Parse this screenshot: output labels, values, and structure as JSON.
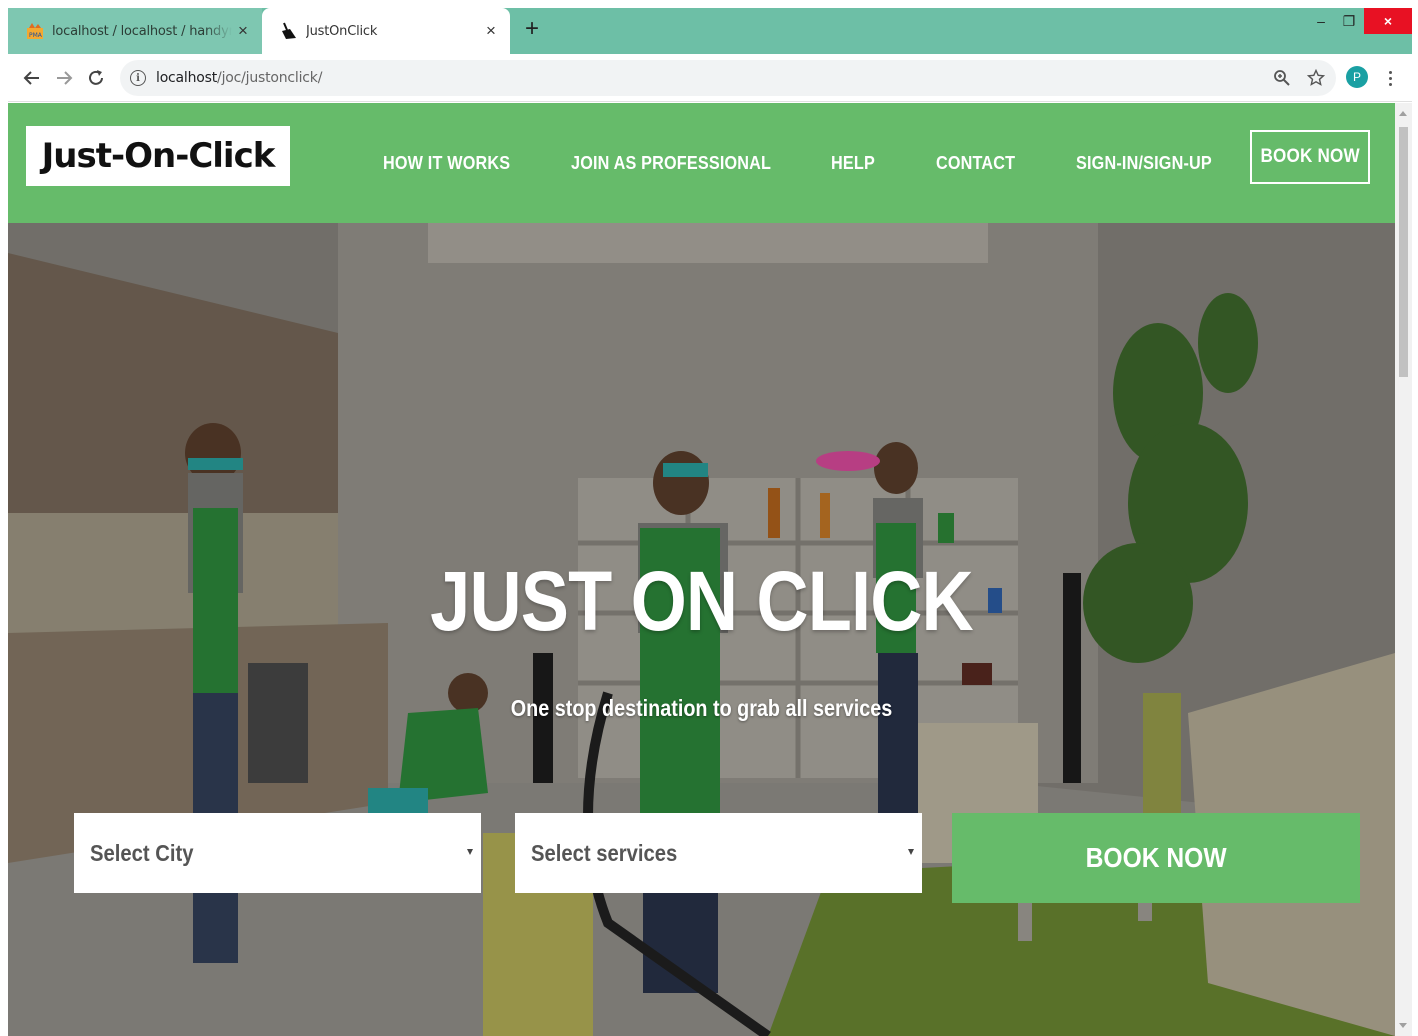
{
  "browser": {
    "tabs": [
      {
        "title": "localhost / localhost / handyman",
        "favicon": "phpmyadmin-icon",
        "active": false
      },
      {
        "title": "JustOnClick",
        "favicon": "broom-icon",
        "active": true
      }
    ],
    "new_tab": "+",
    "close_tab": "×",
    "window_controls": {
      "minimize": "–",
      "maximize": "❐",
      "close": "×"
    },
    "url_host": "localhost",
    "url_path": "/joc/justonclick/",
    "profile_initial": "P"
  },
  "site": {
    "logo": "Just-On-Click",
    "nav": [
      {
        "label": "HOW IT WORKS"
      },
      {
        "label": "JOIN AS PROFESSIONAL"
      },
      {
        "label": "HELP"
      },
      {
        "label": "CONTACT"
      },
      {
        "label": "SIGN-IN/SIGN-UP"
      }
    ],
    "nav_book": "BOOK NOW",
    "hero": {
      "title": "JUST ON CLICK",
      "subtitle": "One stop destination to grab all services",
      "city_select": "Select City",
      "service_select": "Select services",
      "book_button": "BOOK NOW"
    }
  },
  "colors": {
    "brand_green": "#66bb6a",
    "tab_strip": "#6dbfa6",
    "close_red": "#e81123"
  }
}
